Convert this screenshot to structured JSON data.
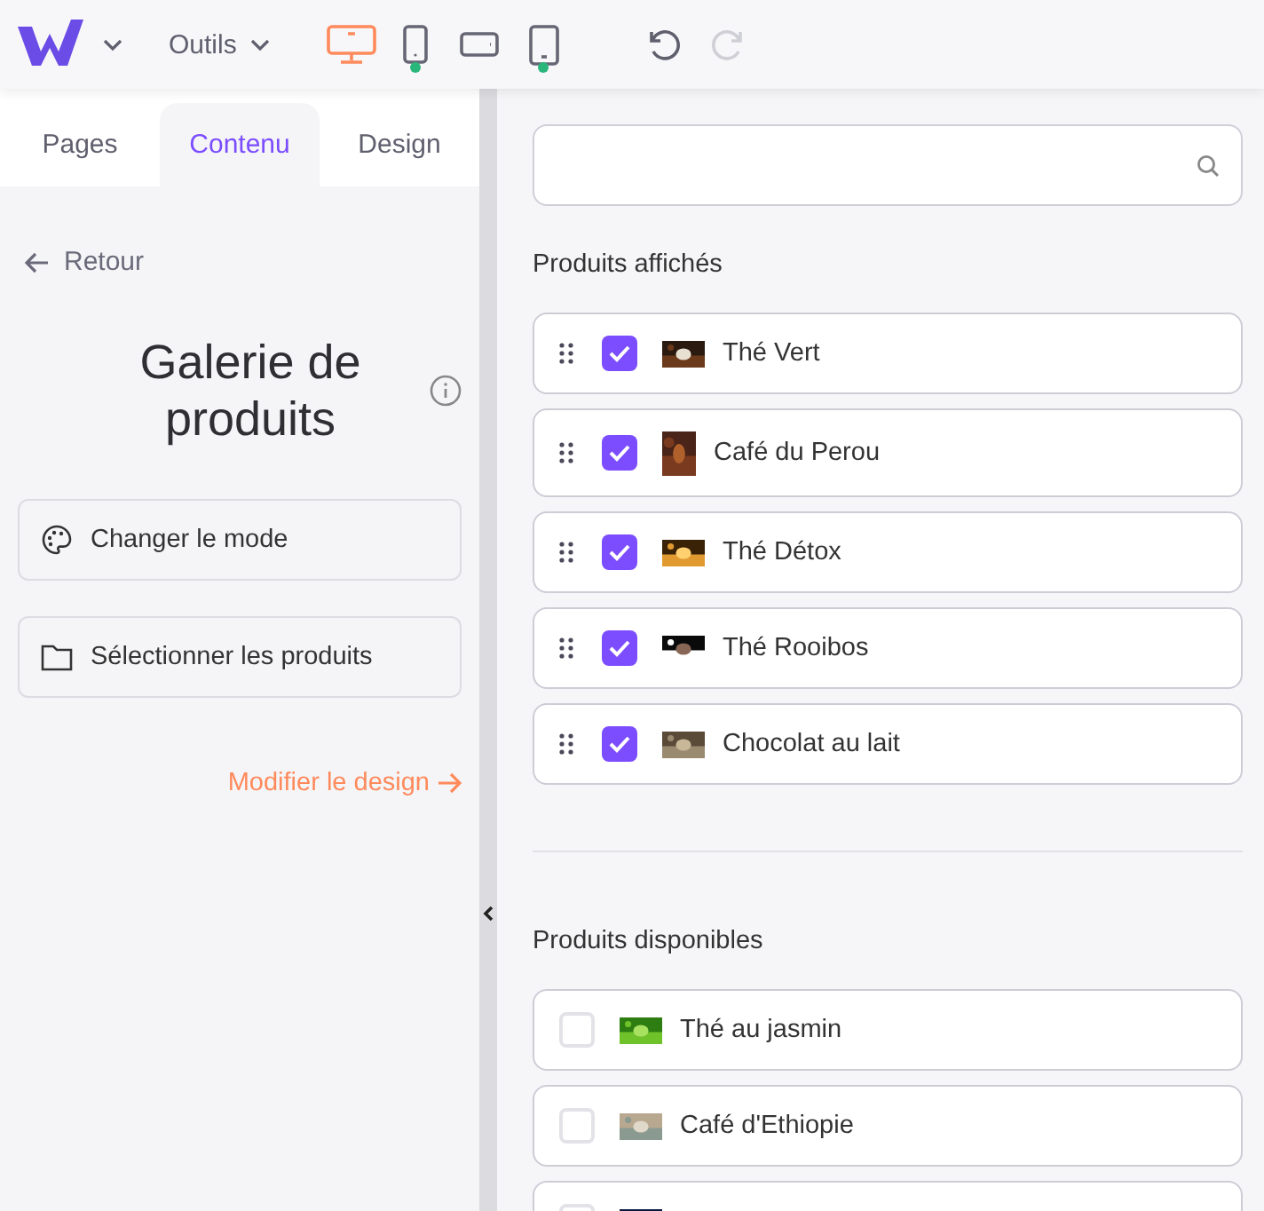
{
  "toolbar": {
    "menu": "Outils",
    "devices": [
      {
        "kind": "desktop",
        "selected": true,
        "dot": false
      },
      {
        "kind": "phone",
        "selected": false,
        "dot": true
      },
      {
        "kind": "tablet-landscape",
        "selected": false,
        "dot": false
      },
      {
        "kind": "tablet",
        "selected": false,
        "dot": true
      }
    ],
    "undo": {
      "disabled": false
    },
    "redo": {
      "disabled": true
    }
  },
  "tabs": [
    {
      "label": "Pages",
      "selected": false
    },
    {
      "label": "Contenu",
      "selected": true
    },
    {
      "label": "Design",
      "selected": false
    }
  ],
  "back": "Retour",
  "title": "Galerie de produits",
  "actions": [
    {
      "kind": "palette",
      "label": "Changer le mode"
    },
    {
      "kind": "folder",
      "label": "Sélectionner les produits"
    }
  ],
  "design_link": "Modifier le design",
  "displayed": {
    "heading": "Produits affichés",
    "items": [
      {
        "name": "Thé Vert",
        "checked": true,
        "kind": "wide"
      },
      {
        "name": "Café du Perou",
        "checked": true,
        "kind": "tall"
      },
      {
        "name": "Thé Détox",
        "checked": true,
        "kind": "wide"
      },
      {
        "name": "Thé Rooibos",
        "checked": true,
        "kind": "wide"
      },
      {
        "name": "Chocolat au lait",
        "checked": true,
        "kind": "wide"
      }
    ]
  },
  "available": {
    "heading": "Produits disponibles",
    "items": [
      {
        "name": "Thé au jasmin",
        "checked": false
      },
      {
        "name": "Café d'Ethiopie",
        "checked": false
      },
      {
        "checked": false
      }
    ]
  }
}
